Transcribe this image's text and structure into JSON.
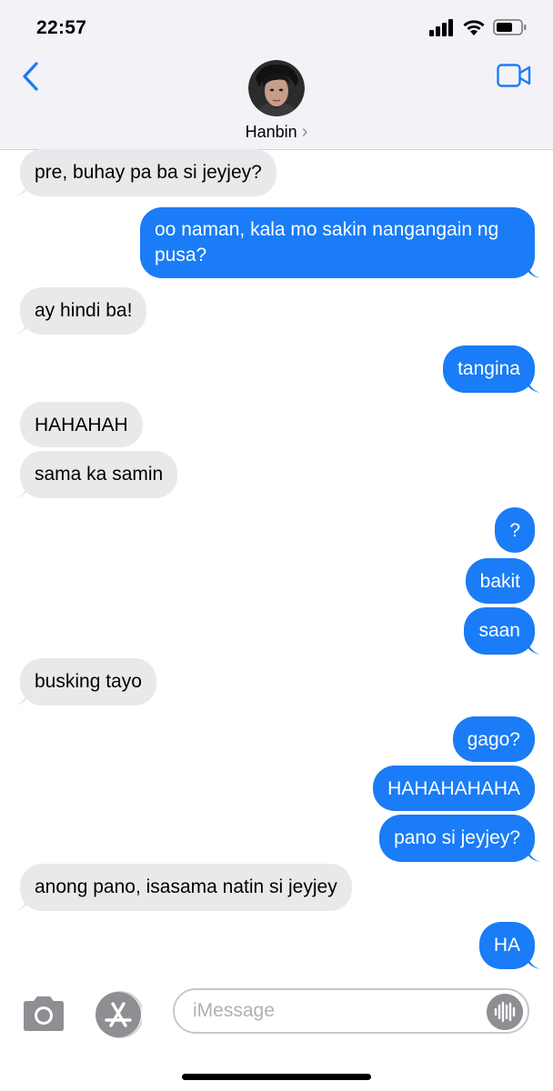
{
  "status": {
    "time": "22:57"
  },
  "contact": {
    "name": "Hanbin",
    "chevron": "›"
  },
  "messages": [
    {
      "dir": "in",
      "text": "pre, buhay pa ba si jeyjey?"
    },
    {
      "dir": "out",
      "text": "oo naman, kala mo sakin nangangain ng pusa?"
    },
    {
      "dir": "in",
      "text": "ay hindi ba!"
    },
    {
      "dir": "out",
      "text": "tangina"
    },
    {
      "dir": "in",
      "text": "HAHAHAH"
    },
    {
      "dir": "in",
      "text": "sama ka samin"
    },
    {
      "dir": "out",
      "text": "?"
    },
    {
      "dir": "out",
      "text": "bakit"
    },
    {
      "dir": "out",
      "text": "saan"
    },
    {
      "dir": "in",
      "text": "busking tayo"
    },
    {
      "dir": "out",
      "text": "gago?"
    },
    {
      "dir": "out",
      "text": "HAHAHAHAHA"
    },
    {
      "dir": "out",
      "text": "pano si jeyjey?"
    },
    {
      "dir": "in",
      "text": "anong pano, isasama natin si jeyjey"
    },
    {
      "dir": "out",
      "text": "HA"
    }
  ],
  "composer": {
    "placeholder": "iMessage"
  },
  "colors": {
    "outgoing": "#1a7cf6",
    "incoming": "#e9e9eb",
    "header": "#f2f2f7"
  },
  "icons": [
    "back-chevron-icon",
    "video-camera-icon",
    "camera-icon",
    "app-store-icon",
    "audio-waveform-icon",
    "signal-icon",
    "wifi-icon",
    "battery-icon"
  ]
}
